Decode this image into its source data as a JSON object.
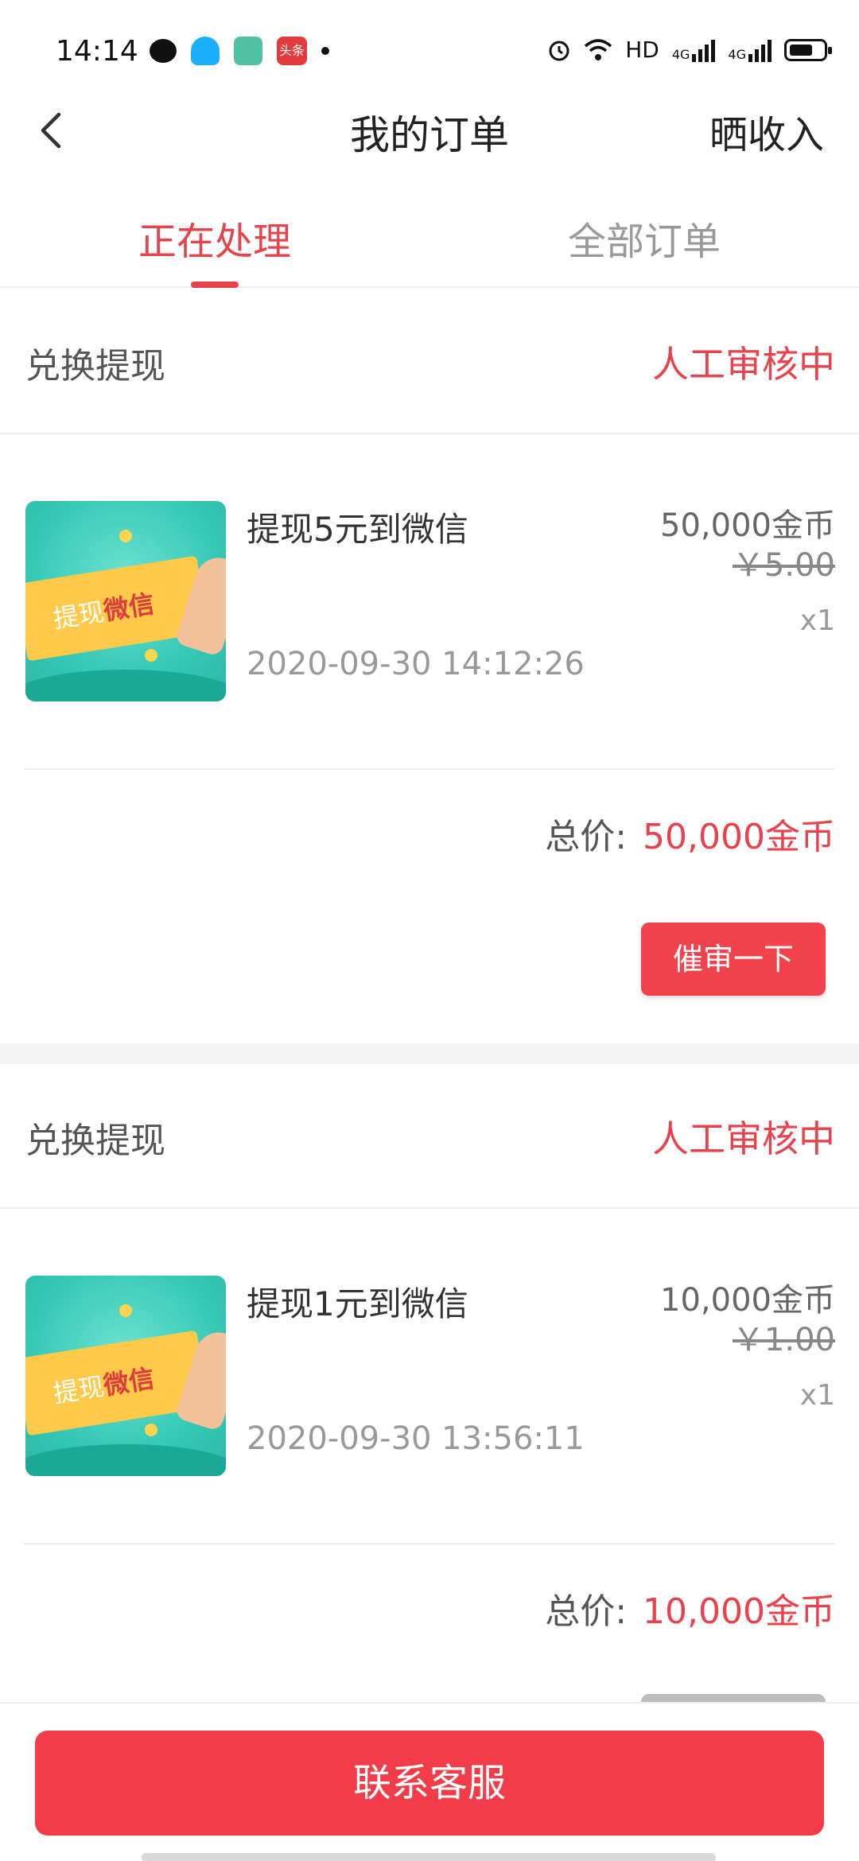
{
  "status_bar": {
    "time": "14:14",
    "network_label": "HD",
    "sig1_label": "4G",
    "sig2_label": "4G"
  },
  "header": {
    "title": "我的订单",
    "right_action": "晒收入"
  },
  "tabs": [
    {
      "label": "正在处理",
      "active": true
    },
    {
      "label": "全部订单",
      "active": false
    }
  ],
  "orders": [
    {
      "type": "兑换提现",
      "status": "人工审核中",
      "thumb_text_1": "提现",
      "thumb_text_2": "微信",
      "name": "提现5元到微信",
      "time": "2020-09-30 14:12:26",
      "coins": "50,000金币",
      "price": "￥5.00",
      "qty": "x1",
      "total_label": "总价:",
      "total_value": "50,000金币",
      "action": "催审一下"
    },
    {
      "type": "兑换提现",
      "status": "人工审核中",
      "thumb_text_1": "提现",
      "thumb_text_2": "微信",
      "name": "提现1元到微信",
      "time": "2020-09-30 13:56:11",
      "coins": "10,000金币",
      "price": "￥1.00",
      "qty": "x1",
      "total_label": "总价:",
      "total_value": "10,000金币"
    }
  ],
  "bottom": {
    "contact_label": "联系客服"
  },
  "colors": {
    "accent": "#e8434d",
    "button": "#f23c47"
  }
}
